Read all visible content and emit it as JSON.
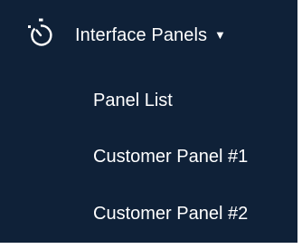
{
  "nav": {
    "group": {
      "icon": "stopwatch-icon",
      "label": "Interface Panels",
      "caret_icon": "caret-down-icon",
      "caret_glyph": "▼",
      "expanded": true
    },
    "items": [
      {
        "label": "Panel List"
      },
      {
        "label": "Customer Panel #1"
      },
      {
        "label": "Customer Panel #2"
      }
    ]
  },
  "colors": {
    "background": "#0f2138",
    "text": "#ffffff",
    "page": "#ffffff"
  }
}
